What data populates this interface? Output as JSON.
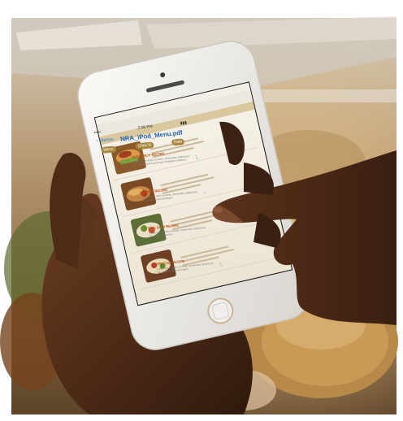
{
  "phone": {
    "status_bar": {
      "carrier": "••••• ",
      "time": "2:06 PM",
      "battery": "▮▮▮"
    },
    "nav": {
      "back_label": "‹ Menus",
      "title": "NRA_iPod_Menu.pdf"
    },
    "toolbar": [
      "Menu",
      "Chec kl",
      "Ralo"
    ],
    "menu_items": [
      {
        "heading": "SANDWICH RECIPE",
        "body": "Lorem ipsum dolor sit amet, consectetur adipiscing elit, sed do eiusmod tempor incididunt ut labore.",
        "page": "1"
      },
      {
        "heading": "ENTREE RECIPE",
        "body": "Lorem ipsum dolor sit amet, consectetur adipiscing elit, sed do eiusmod tempor.",
        "page": "+"
      },
      {
        "heading": "SIDE DISH RECIPE",
        "body": "Lorem ipsum dolor sit amet, consectetur adipiscing elit, sed do eiusmod.",
        "page": ""
      },
      {
        "heading": "SPECIAL RECIPE",
        "body": "Lorem ipsum dolor sit amet, consectetur adipiscing elit, sed do eiusmod tempor.",
        "page": "1"
      }
    ]
  },
  "colors": {
    "phone_body": "#f3f1ee",
    "screen_bg": "#f6f0e2",
    "accent": "#b45519",
    "link": "#2f7fd8",
    "skin": "#4a2a18"
  }
}
